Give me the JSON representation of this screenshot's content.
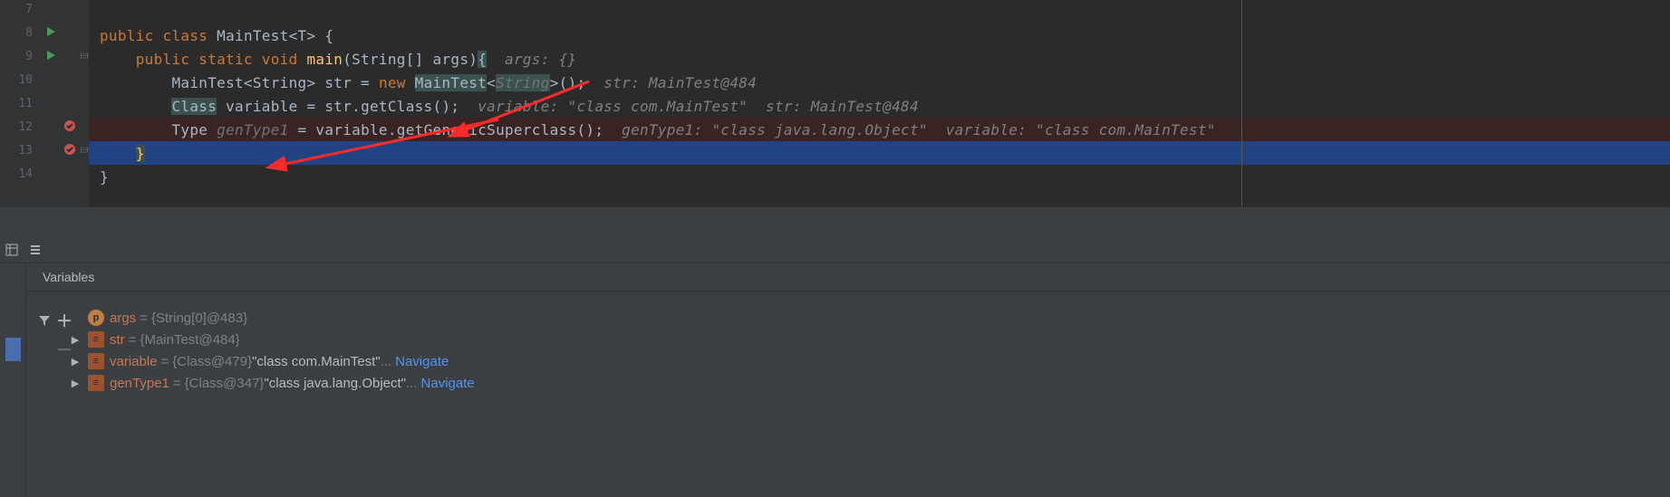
{
  "gutter": {
    "line_numbers": [
      "7",
      "8",
      "9",
      "10",
      "11",
      "12",
      "13",
      "14"
    ]
  },
  "code": {
    "l8": {
      "kw1": "public ",
      "kw2": "class ",
      "cls": "MainTest",
      "gen": "<T> {",
      "pre": ""
    },
    "l9": {
      "pre": "    ",
      "kw1": "public static ",
      "kw2": "void ",
      "fn": "main",
      "args": "(String[] args)",
      "br": "{",
      "hint": "  args: {}"
    },
    "l10": {
      "pre": "        ",
      "t1": "MainTest<String> str = ",
      "kw": "new ",
      "hl": "MainTest",
      "t2": "<",
      "gen": "String",
      "t3": ">();",
      "hint": "  str: MainTest@484"
    },
    "l11": {
      "pre": "        ",
      "hl": "Class",
      "t1": " variable = str.getClass();",
      "hint": "  variable: \"class com.MainTest\"  str: MainTest@484"
    },
    "l12": {
      "pre": "        ",
      "t0": "Type ",
      "gt": "genType1",
      "t1": " = variable.getGenericSuperclass();",
      "hint": "  genType1: \"class java.lang.Object\"  variable: \"class com.MainTest\""
    },
    "l13": {
      "pre": "    ",
      "br": "}"
    },
    "l14": {
      "pre": "",
      "br": "}"
    }
  },
  "vars_panel": {
    "title": "Variables",
    "rows": {
      "args": {
        "name": "args",
        "eq": " = ",
        "val": "{String[0]@483}"
      },
      "str": {
        "name": "str",
        "eq": " = ",
        "val": "{MainTest@484}"
      },
      "variable": {
        "name": "variable",
        "eq": " = ",
        "val1": "{Class@479} ",
        "val2": "\"class com.MainTest\"",
        "ell": " ... ",
        "nav": "Navigate"
      },
      "gentype": {
        "name": "genType1",
        "eq": " = ",
        "val1": "{Class@347} ",
        "val2": "\"class java.lang.Object\"",
        "ell": " ... ",
        "nav": "Navigate"
      }
    }
  },
  "icons": {
    "filter": "filter-icon",
    "plus": "plus-icon",
    "minus": "minus-icon",
    "table": "table-icon",
    "thread": "thread-icon"
  }
}
